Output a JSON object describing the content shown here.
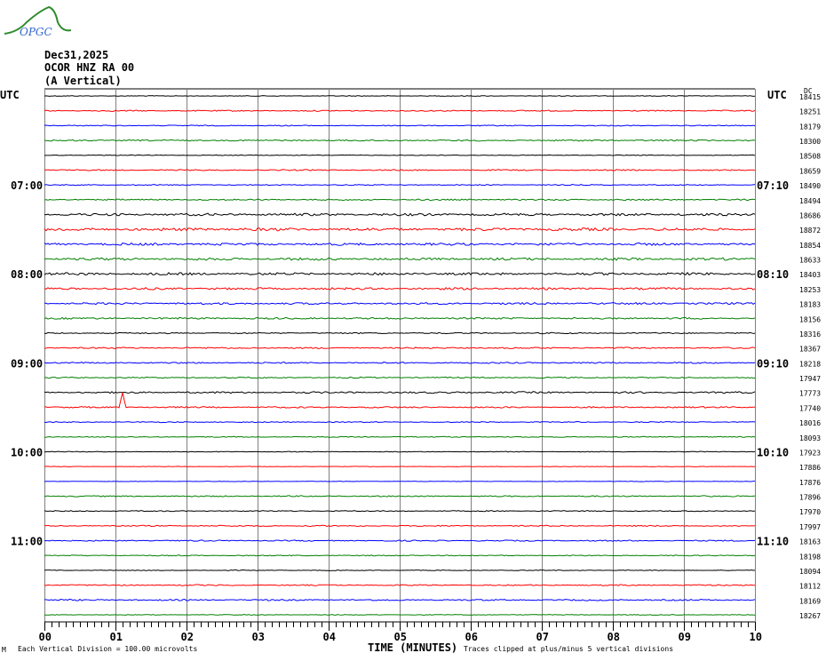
{
  "logo": {
    "text": "OPGC"
  },
  "header": {
    "date": "Dec31,2025",
    "station": "OCOR HNZ RA 00",
    "component": "(A Vertical)"
  },
  "left_utc": "UTC",
  "right_utc": "UTC",
  "dc_label": "DC",
  "footer": {
    "division": "Each Vertical Division =  100.00 microvolts",
    "xlabel": "TIME (MINUTES)",
    "clip": "Traces clipped at plus/minus 5 vertical divisions",
    "corner": "M"
  },
  "colors": {
    "cycle": [
      "#000000",
      "#ff0000",
      "#0000ff",
      "#008000"
    ],
    "grid": "#808080"
  },
  "chart_data": {
    "type": "line",
    "title": "OCOR HNZ RA 00 (A Vertical) Dec31,2025",
    "xlabel": "TIME (MINUTES)",
    "xlim": [
      0,
      10
    ],
    "x_ticks": [
      "00",
      "01",
      "02",
      "03",
      "04",
      "05",
      "06",
      "07",
      "08",
      "09",
      "10"
    ],
    "minor_ticks_per_minute": 10,
    "left_time_labels": [
      {
        "trace": 6,
        "text": "07:00"
      },
      {
        "trace": 12,
        "text": "08:00"
      },
      {
        "trace": 18,
        "text": "09:00"
      },
      {
        "trace": 24,
        "text": "10:00"
      },
      {
        "trace": 30,
        "text": "11:00"
      }
    ],
    "right_time_labels": [
      {
        "trace": 6,
        "text": "07:10"
      },
      {
        "trace": 12,
        "text": "08:10"
      },
      {
        "trace": 18,
        "text": "09:10"
      },
      {
        "trace": 24,
        "text": "10:10"
      },
      {
        "trace": 30,
        "text": "11:10"
      }
    ],
    "dc_values": [
      "18415",
      "18251",
      "18179",
      "18300",
      "18508",
      "18659",
      "18490",
      "18494",
      "18686",
      "18872",
      "18854",
      "18633",
      "18403",
      "18253",
      "18183",
      "18156",
      "18316",
      "18367",
      "18218",
      "17947",
      "17773",
      "17740",
      "18016",
      "18093",
      "17923",
      "17886",
      "17876",
      "17896",
      "17970",
      "17997",
      "18163",
      "18198",
      "18094",
      "18112",
      "18169",
      "18267"
    ],
    "noise_level": [
      0.3,
      0.5,
      0.4,
      0.6,
      0.3,
      0.5,
      0.4,
      0.6,
      1.0,
      1.2,
      1.0,
      1.0,
      1.0,
      0.9,
      0.8,
      0.7,
      0.5,
      0.6,
      0.6,
      0.5,
      0.7,
      0.6,
      0.4,
      0.4,
      0.3,
      0.2,
      0.2,
      0.5,
      0.4,
      0.5,
      0.5,
      0.4,
      0.3,
      0.5,
      0.6,
      0.3
    ],
    "events": [
      {
        "trace": 21,
        "minute": 1.1,
        "amplitude_divisions": 1.0
      }
    ],
    "units": "microvolts",
    "vertical_division_uV": 100
  }
}
